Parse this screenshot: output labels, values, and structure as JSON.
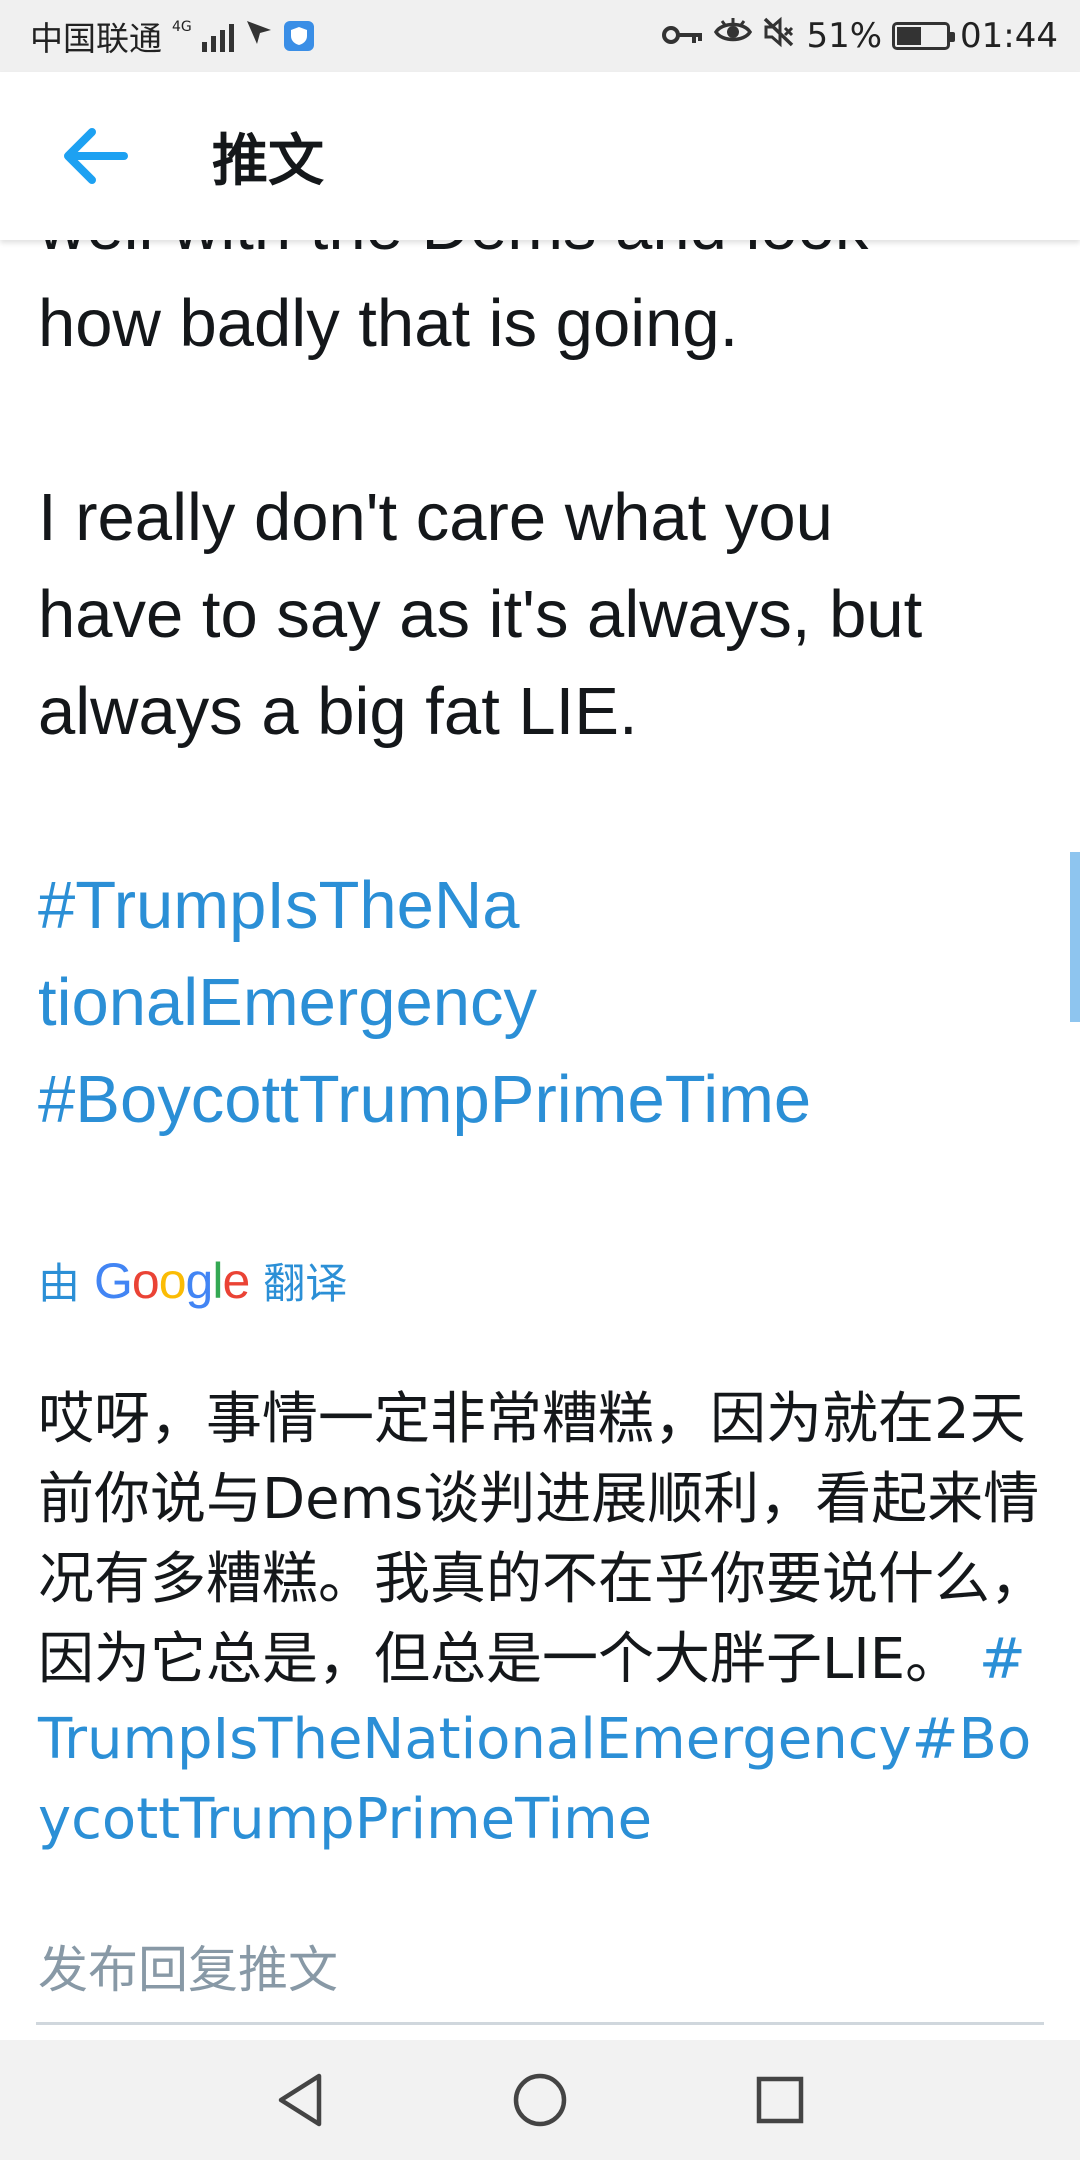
{
  "status_bar": {
    "carrier": "中国联通",
    "network": "4G",
    "battery_percent": "51%",
    "battery_level": 0.51,
    "time": "01:44",
    "icons": [
      "signal-icon",
      "location-arrow-icon",
      "shield-app-icon",
      "key-icon",
      "eye-icon",
      "mute-icon",
      "battery-icon"
    ]
  },
  "app_bar": {
    "back_icon": "arrow-left-icon",
    "title": "推文"
  },
  "tweet": {
    "lines_top": [
      "well with the Dems and look",
      "how badly that is going."
    ],
    "paragraph_2": [
      "I really don't care what you",
      "have to say as it's always, but",
      "always a big fat LIE."
    ],
    "hashtags": [
      "#TrumpIsTheNa",
      "tionalEmergency",
      "#BoycottTrumpPrimeTime"
    ]
  },
  "translation_credit": {
    "prefix": "由",
    "brand": "Google",
    "suffix": "翻译",
    "brand_colors": [
      "#4285F4",
      "#EA4335",
      "#FBBC05",
      "#4285F4",
      "#34A853",
      "#EA4335"
    ]
  },
  "translation": {
    "text": "哎呀，事情一定非常糟糕，因为就在2天前你说与Dems谈判进展顺利，看起来情况有多糟糕。我真的不在乎你要说什么，因为它总是，但总是一个大胖子LIE。",
    "hashtags_inline": " #TrumpIsTheNationalEmergency#BoycottTrumpPrimeTime"
  },
  "reply": {
    "placeholder": "发布回复推文"
  },
  "nav_bar": {
    "back": "triangle-back-icon",
    "home": "circle-home-icon",
    "recents": "square-recents-icon"
  },
  "colors": {
    "link": "#2b8fd6",
    "accent": "#1da1f2",
    "text": "#14171a",
    "placeholder": "#8899a6"
  }
}
